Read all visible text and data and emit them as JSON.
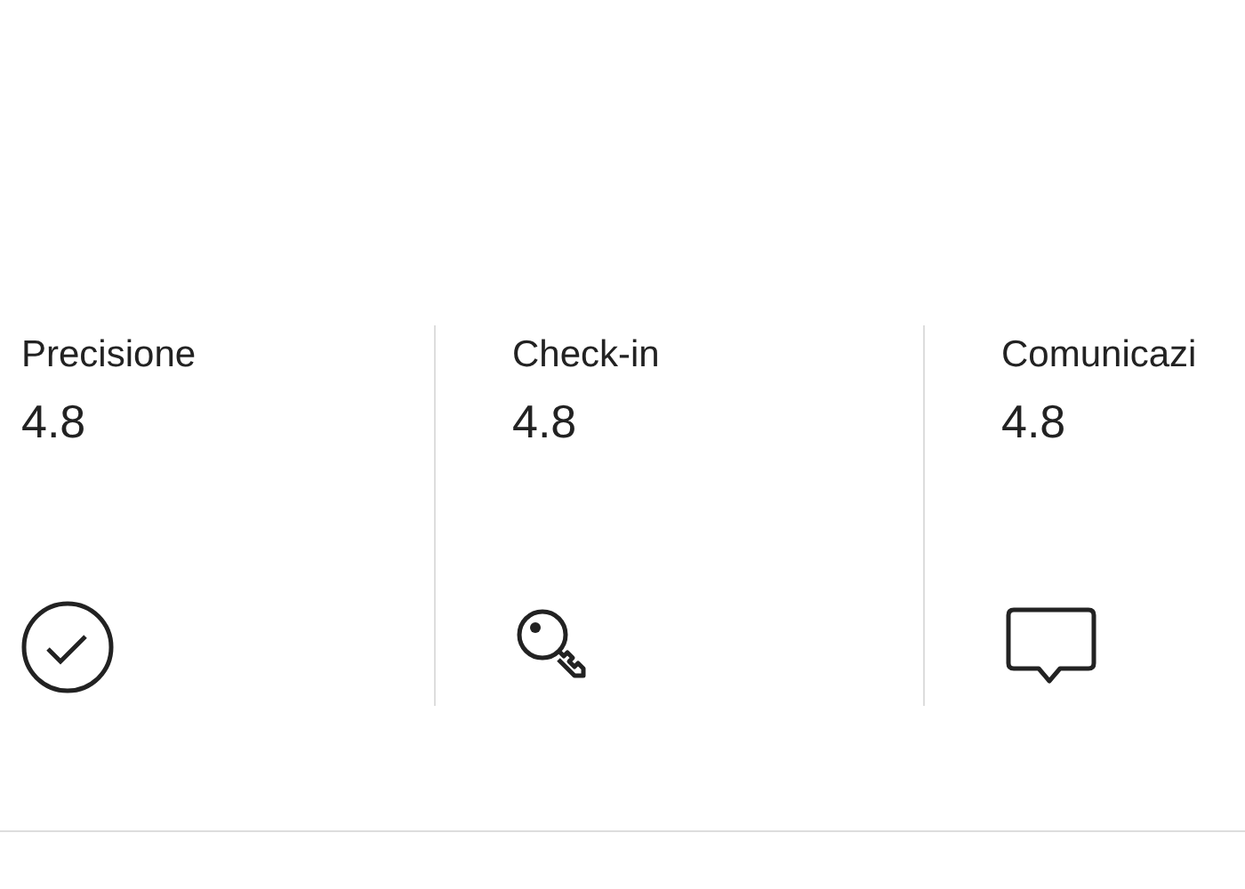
{
  "categories": [
    {
      "kind": "check",
      "label": "Precisione",
      "rating": "4.8"
    },
    {
      "kind": "key",
      "label": "Check-in",
      "rating": "4.8"
    },
    {
      "kind": "chat",
      "label": "Comunicazi",
      "rating": "4.8"
    }
  ]
}
